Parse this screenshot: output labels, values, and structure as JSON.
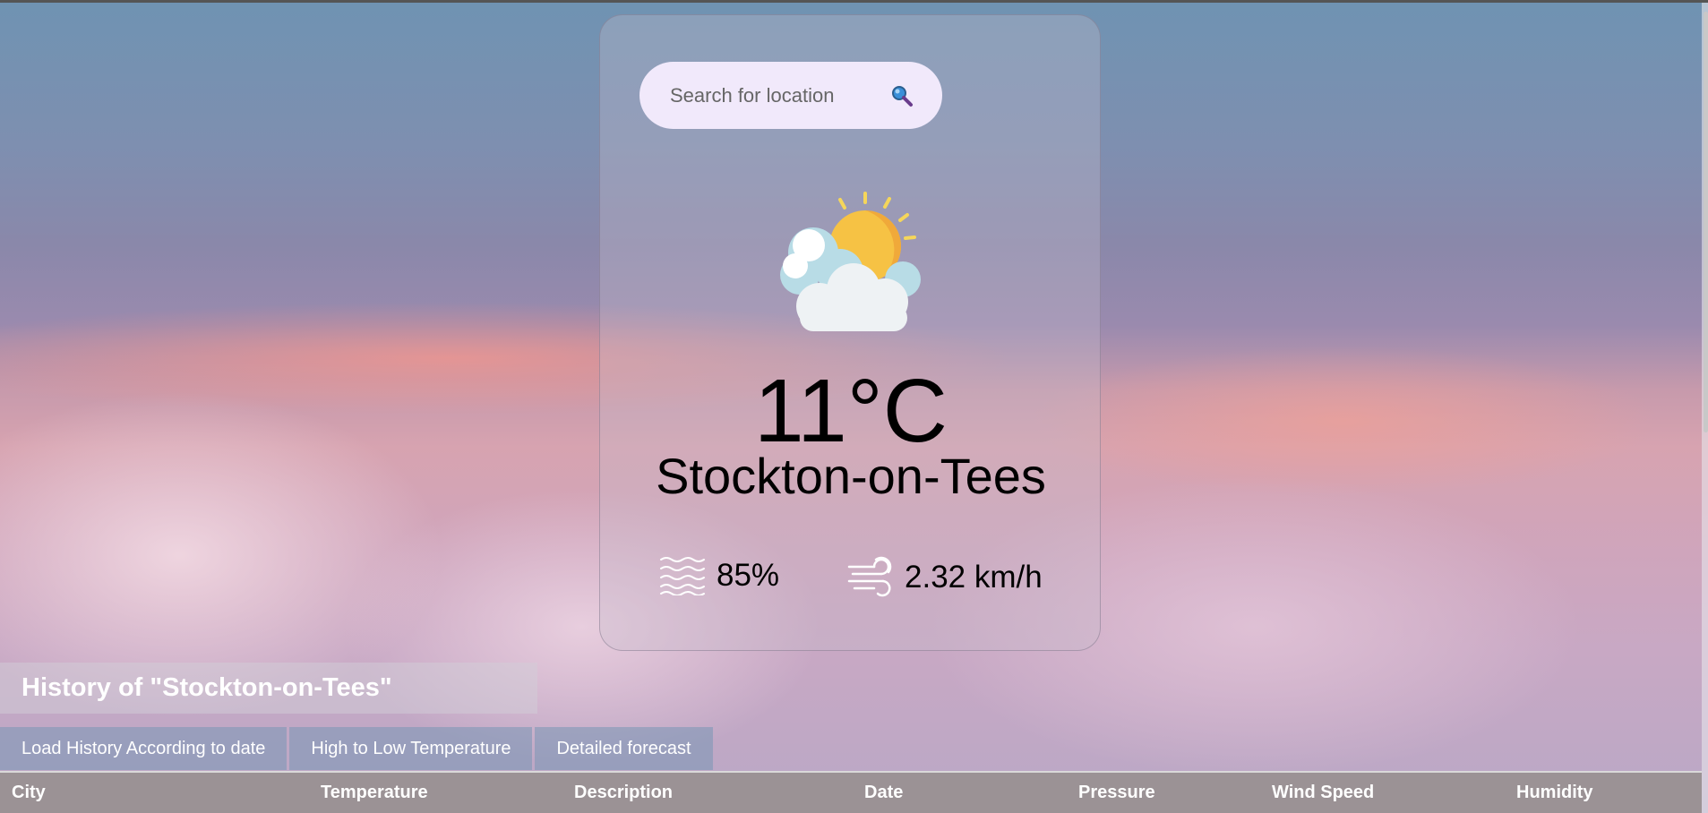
{
  "search": {
    "placeholder": "Search for location"
  },
  "weather": {
    "icon": "partly-cloudy-icon",
    "temperature": "11°C",
    "city": "Stockton-on-Tees",
    "humidity": "85%",
    "wind_speed": "2.32 km/h"
  },
  "history": {
    "title": "History of \"Stockton-on-Tees\"",
    "tabs": [
      {
        "label": "Load History According to date"
      },
      {
        "label": "High to Low Temperature"
      },
      {
        "label": "Detailed forecast"
      }
    ],
    "columns": [
      "City",
      "Temperature",
      "Description",
      "Date",
      "Pressure",
      "Wind Speed",
      "Humidity"
    ]
  },
  "colors": {
    "search_bg": "#f1e9fb",
    "table_header_bg": "#9b9295",
    "tab_bg": "#7896b4"
  }
}
